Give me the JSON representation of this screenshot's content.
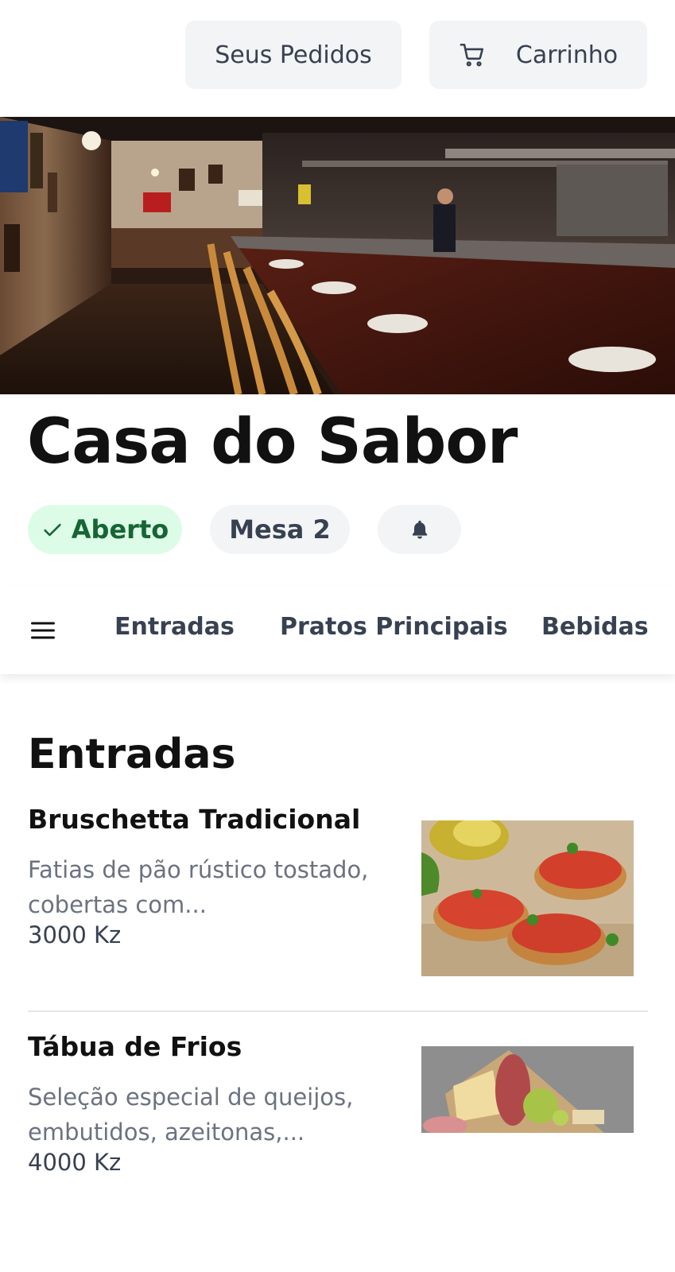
{
  "header": {
    "orders_label": "Seus Pedidos",
    "cart_label": "Carrinho",
    "cart_icon": "cart-icon"
  },
  "restaurant": {
    "name": "Casa do Sabor",
    "status_label": "Aberto",
    "table_label": "Mesa 2",
    "bell_icon": "bell-icon"
  },
  "nav": {
    "menu_icon": "hamburger-menu-icon",
    "tabs": [
      {
        "label": "Entradas"
      },
      {
        "label": "Pratos Principais"
      },
      {
        "label": "Bebidas"
      }
    ]
  },
  "section": {
    "title": "Entradas",
    "items": [
      {
        "name": "Bruschetta Tradicional",
        "description": "Fatias de pão rústico tostado, cobertas com...",
        "price": "3000 Kz"
      },
      {
        "name": "Tábua de Frios",
        "description": "Seleção especial de queijos, embutidos, azeitonas,...",
        "price": "4000 Kz"
      }
    ]
  },
  "colors": {
    "status_bg": "#dcfce7",
    "status_text": "#166534",
    "chip_bg": "#f3f4f6",
    "muted_text": "#6b7280"
  }
}
